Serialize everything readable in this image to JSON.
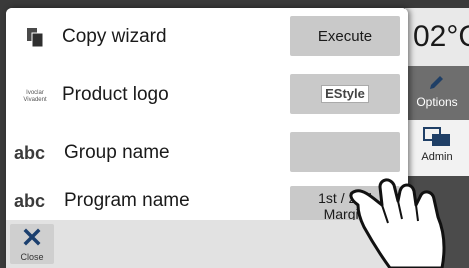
{
  "background": {
    "temp_value": "02°C",
    "options_label": "Options",
    "admin_label": "Admin"
  },
  "rows": [
    {
      "icon": "copy-icon",
      "label": "Copy wizard",
      "button": "Execute"
    },
    {
      "icon": "brand-logo-icon",
      "icon_text": "Ivoclar Vivadent",
      "label": "Product logo",
      "button": "EStyle"
    },
    {
      "icon_text": "abc",
      "label": "Group name",
      "button": ""
    },
    {
      "icon_text": "abc",
      "label": "Program name",
      "button_line1": "1st / 2nd",
      "button_line2": "Margin"
    }
  ],
  "footer": {
    "close_label": "Close"
  },
  "colors": {
    "button_gray": "#c9c9c9",
    "panel_dark": "#3a3a3a",
    "close_blue": "#1b3f6e"
  }
}
